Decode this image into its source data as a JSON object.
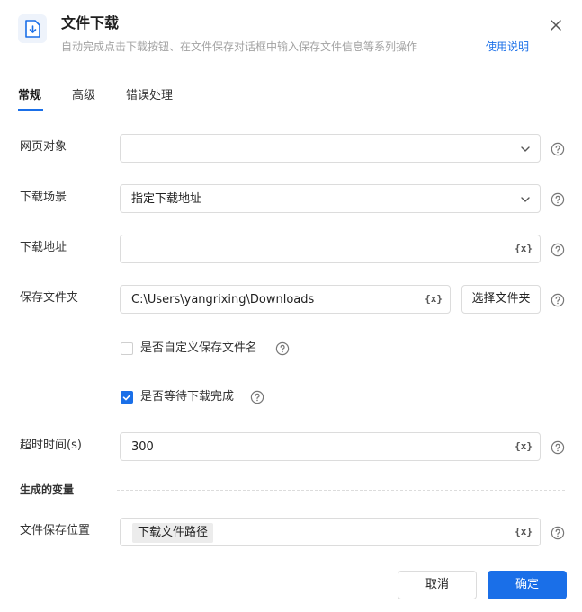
{
  "header": {
    "title": "文件下载",
    "subtitle": "自动完成点击下载按钮、在文件保存对话框中输入保存文件信息等系列操作",
    "help_link": "使用说明"
  },
  "tabs": [
    {
      "label": "常规",
      "active": true
    },
    {
      "label": "高级",
      "active": false
    },
    {
      "label": "错误处理",
      "active": false
    }
  ],
  "form": {
    "web_object": {
      "label": "网页对象",
      "value": ""
    },
    "download_scene": {
      "label": "下载场景",
      "value": "指定下载地址"
    },
    "download_url": {
      "label": "下载地址",
      "value": ""
    },
    "save_folder": {
      "label": "保存文件夹",
      "value": "C:\\Users\\yangrixing\\Downloads",
      "button": "选择文件夹"
    },
    "custom_name": {
      "label": "是否自定义保存文件名",
      "checked": false
    },
    "wait_complete": {
      "label": "是否等待下载完成",
      "checked": true
    },
    "timeout": {
      "label": "超时时间(s)",
      "value": "300"
    }
  },
  "variables": {
    "section_title": "生成的变量",
    "save_path": {
      "label": "文件保存位置",
      "chip": "下载文件路径"
    }
  },
  "var_icon": "{x}",
  "footer": {
    "cancel": "取消",
    "confirm": "确定"
  },
  "colors": {
    "accent": "#1a6fe8",
    "border": "#dcdcdc",
    "muted": "#a3a3a3"
  }
}
